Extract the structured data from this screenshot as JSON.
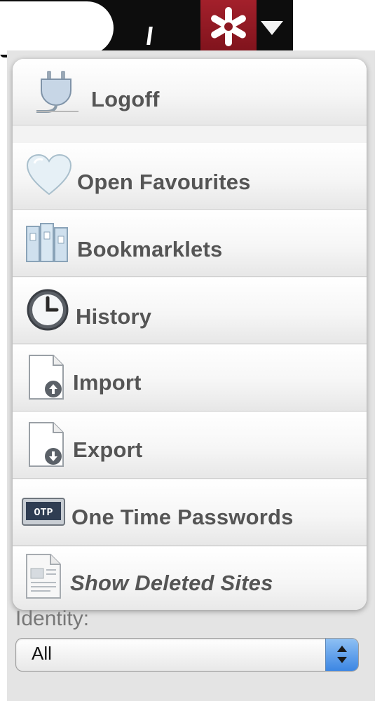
{
  "toolbar": {
    "logo_icon": "lastpass-asterisk-icon",
    "menu_arrow_icon": "triangle-down-icon",
    "brand_color": "#9a1b25"
  },
  "menu": {
    "items": [
      {
        "label": "Logoff",
        "icon": "plug-icon"
      },
      {
        "label": "Open Favourites",
        "icon": "heart-icon"
      },
      {
        "label": "Bookmarklets",
        "icon": "books-icon"
      },
      {
        "label": "History",
        "icon": "clock-icon"
      },
      {
        "label": "Import",
        "icon": "document-upload-icon"
      },
      {
        "label": "Export",
        "icon": "document-download-icon"
      },
      {
        "label": "One Time Passwords",
        "icon": "otp-display-icon"
      },
      {
        "label": "Show Deleted Sites",
        "icon": "deleted-document-icon"
      }
    ]
  },
  "identity": {
    "label": "Identity:",
    "selected": "All"
  }
}
